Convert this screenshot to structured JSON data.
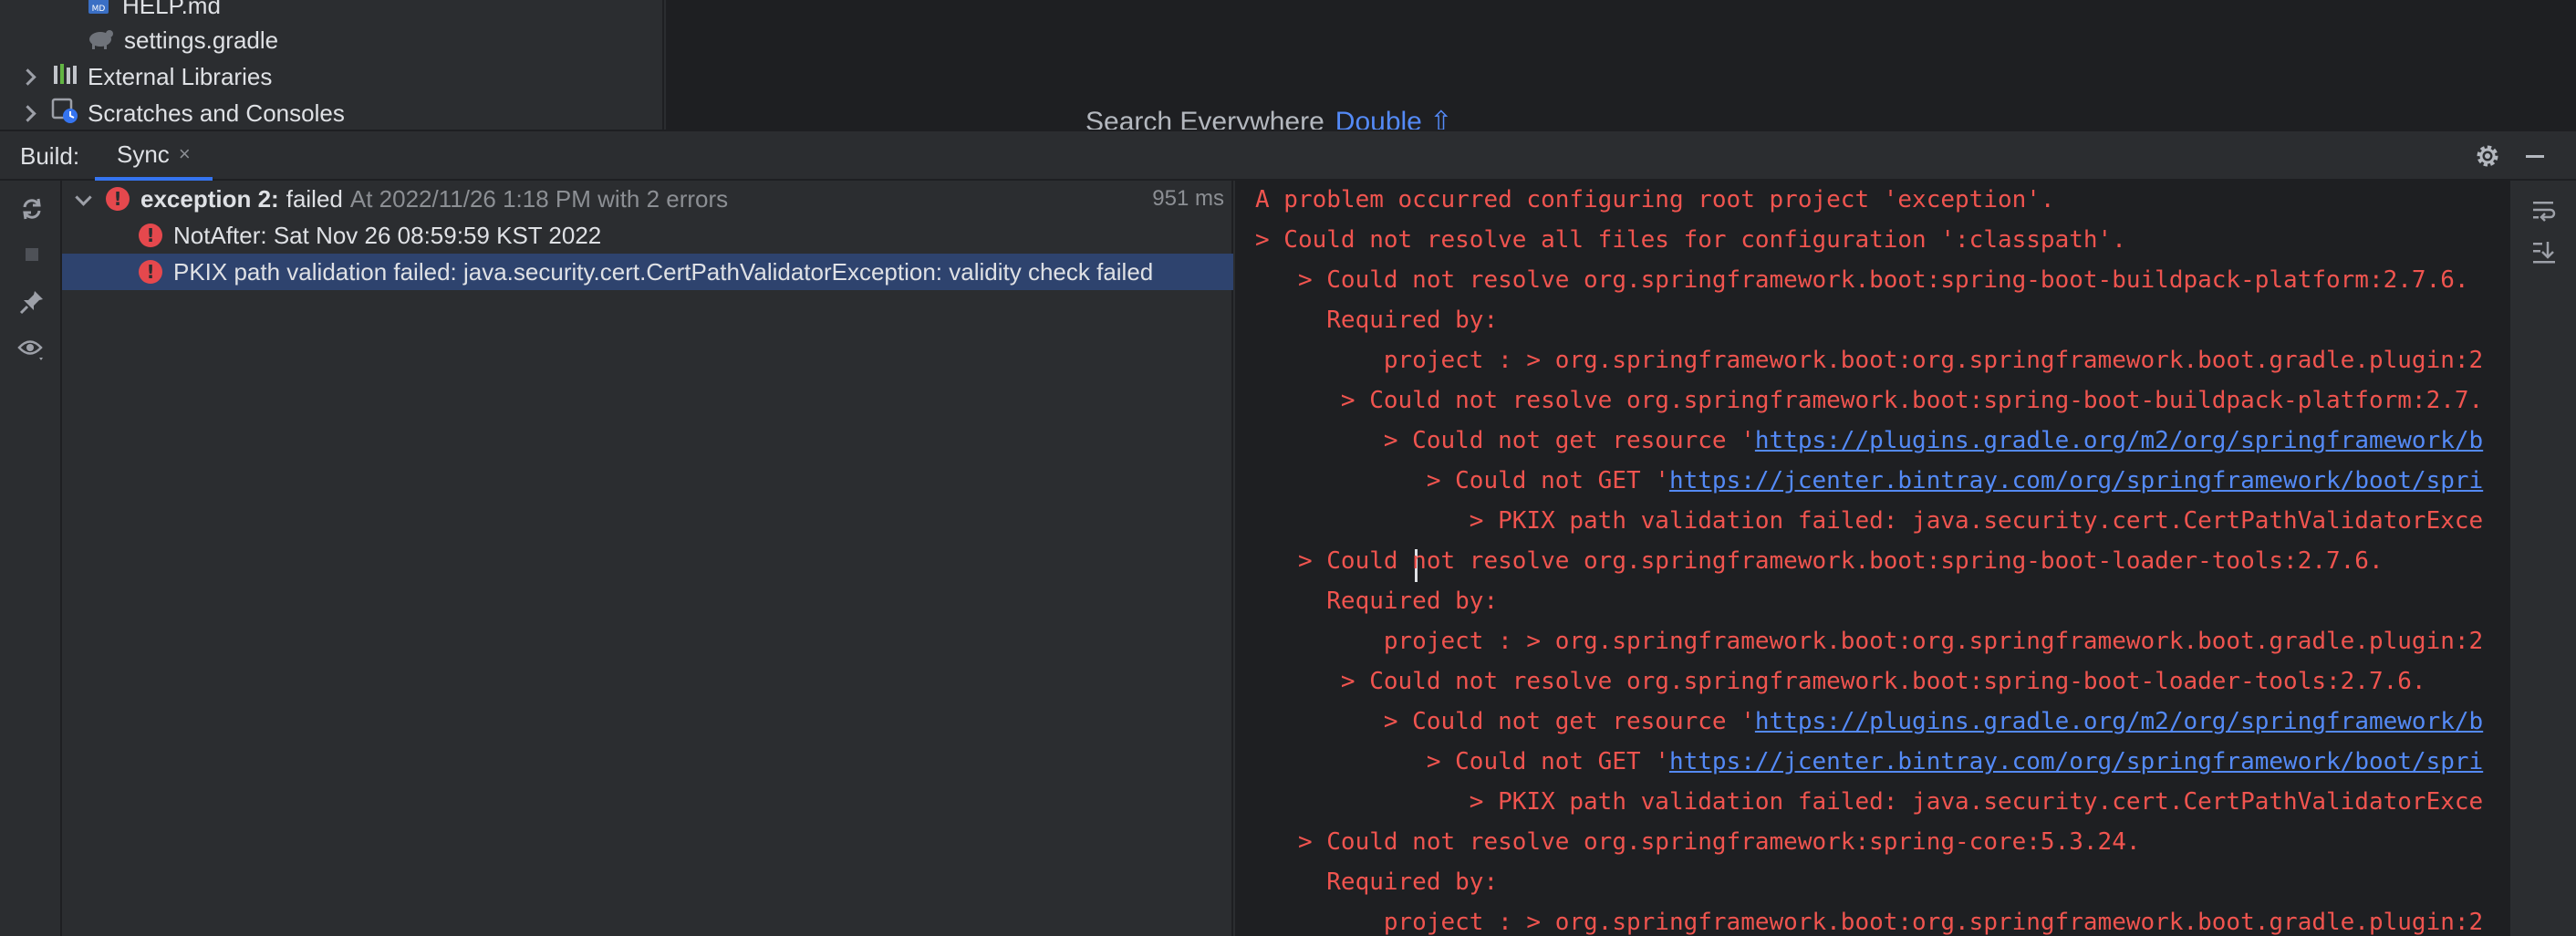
{
  "project_tree": {
    "items": [
      {
        "label": "HELP.md",
        "icon": "markdown-file-icon"
      },
      {
        "label": "settings.gradle",
        "icon": "gradle-file-icon"
      },
      {
        "label": "External Libraries",
        "icon": "library-icon"
      },
      {
        "label": "Scratches and Consoles",
        "icon": "scratches-icon"
      }
    ]
  },
  "editor": {
    "hint_text": "Search Everywhere",
    "hint_shortcut": "Double ⇧"
  },
  "build": {
    "title": "Build:",
    "tab_label": "Sync",
    "tab_close": "×",
    "tree": {
      "root": {
        "name": "exception 2:",
        "status": "failed",
        "meta": "At 2022/11/26 1:18 PM with 2 errors",
        "time": "951 ms"
      },
      "children": [
        {
          "label": "NotAfter: Sat Nov 26 08:59:59 KST 2022"
        },
        {
          "label": "PKIX path validation failed: java.security.cert.CertPathValidatorException: validity check failed"
        }
      ]
    },
    "console": {
      "lines": [
        {
          "text": "A problem occurred configuring root project 'exception'."
        },
        {
          "text": "> Could not resolve all files for configuration ':classpath'."
        },
        {
          "text": "   > Could not resolve org.springframework.boot:spring-boot-buildpack-platform:2.7.6."
        },
        {
          "text": "     Required by:"
        },
        {
          "text": "         project : > org.springframework.boot:org.springframework.boot.gradle.plugin:2"
        },
        {
          "text": "      > Could not resolve org.springframework.boot:spring-boot-buildpack-platform:2.7."
        },
        {
          "text": "         > Could not get resource '",
          "link": "https://plugins.gradle.org/m2/org/springframework/b"
        },
        {
          "text": "            > Could not GET '",
          "link": "https://jcenter.bintray.com/org/springframework/boot/spri"
        },
        {
          "text": "               > PKIX path validation failed: java.security.cert.CertPathValidatorExce"
        },
        {
          "text": "   > Could not resolve org.springframework.boot:spring-boot-loader-tools:2.7.6."
        },
        {
          "text": "     Required by:"
        },
        {
          "text": "         project : > org.springframework.boot:org.springframework.boot.gradle.plugin:2"
        },
        {
          "text": "      > Could not resolve org.springframework.boot:spring-boot-loader-tools:2.7.6."
        },
        {
          "text": "         > Could not get resource '",
          "link": "https://plugins.gradle.org/m2/org/springframework/b"
        },
        {
          "text": "            > Could not GET '",
          "link": "https://jcenter.bintray.com/org/springframework/boot/spri"
        },
        {
          "text": "               > PKIX path validation failed: java.security.cert.CertPathValidatorExce"
        },
        {
          "text": "   > Could not resolve org.springframework:spring-core:5.3.24."
        },
        {
          "text": "     Required by:"
        },
        {
          "text": "         project : > org.springframework.boot:org.springframework.boot.gradle.plugin:2"
        }
      ]
    }
  },
  "colors": {
    "error_red": "#f0544f",
    "link_blue": "#548af7",
    "selection": "#2e436e",
    "accent": "#3574f0"
  }
}
